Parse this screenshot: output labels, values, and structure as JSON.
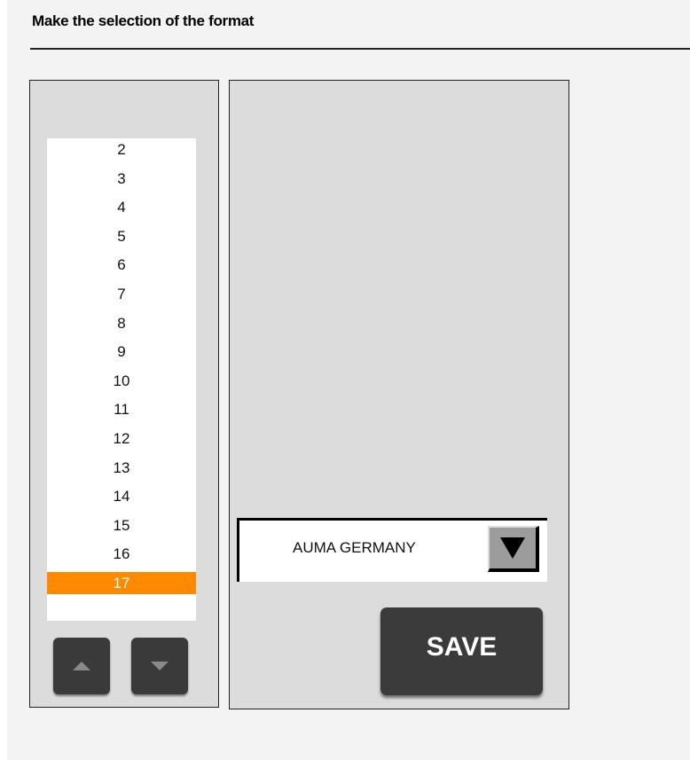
{
  "header": {
    "title": "Make the selection of the format"
  },
  "format_list": {
    "items": [
      "2",
      "3",
      "4",
      "5",
      "6",
      "7",
      "8",
      "9",
      "10",
      "11",
      "12",
      "13",
      "14",
      "15",
      "16",
      "17"
    ],
    "selected": "17"
  },
  "dropdown": {
    "value": "AUMA GERMANY"
  },
  "buttons": {
    "save_label": "SAVE"
  },
  "icons": {
    "scroll_up": "triangle-up-icon",
    "scroll_down": "triangle-down-icon",
    "dropdown": "triangle-down-icon"
  },
  "colors": {
    "selection": "#ff8a00",
    "panel": "#dcdcdc",
    "button": "#3b3b3b"
  }
}
